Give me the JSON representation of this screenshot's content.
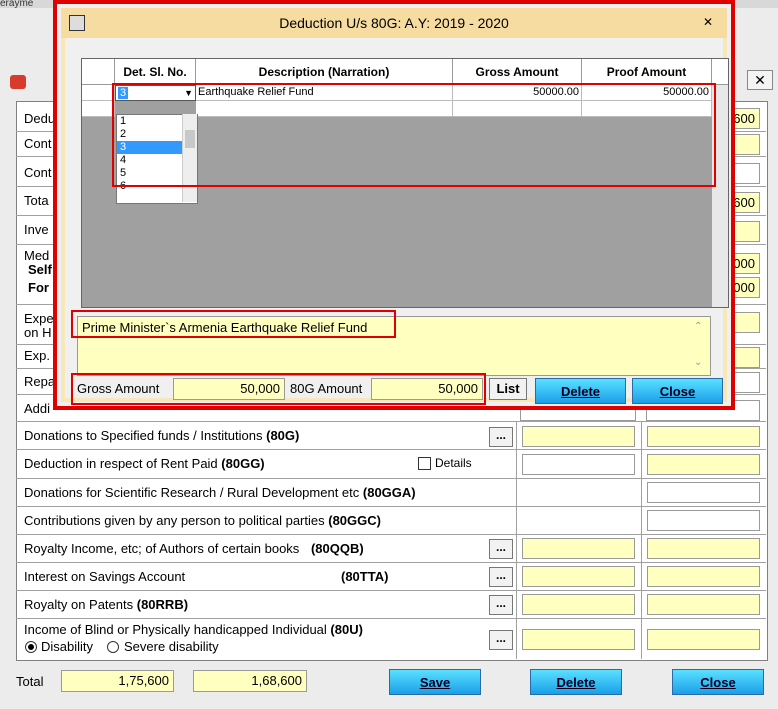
{
  "parent": {
    "top_fragment": "erayme",
    "rows": [
      {
        "label": "Dedu",
        "code": ""
      },
      {
        "label": "Cont",
        "code": ""
      },
      {
        "label": "Cont",
        "code": ""
      },
      {
        "label": "Tota",
        "code": ""
      },
      {
        "label": "Inve",
        "code": ""
      },
      {
        "label": "Med",
        "code": ""
      },
      {
        "label": "Self",
        "code": ""
      },
      {
        "label": "For",
        "code": ""
      },
      {
        "label": "Expe",
        "code": ""
      },
      {
        "label": "on H",
        "code": ""
      },
      {
        "label": "Exp.",
        "code": ""
      },
      {
        "label": "Repa",
        "code": ""
      },
      {
        "label": "Addi",
        "code": ""
      },
      {
        "label": "Donations to Specified funds / Institutions",
        "code": "(80G)"
      },
      {
        "label": "Deduction in respect of Rent Paid",
        "code": "(80GG)"
      },
      {
        "label": "Donations for Scientific Research / Rural Development etc",
        "code": "(80GGA)"
      },
      {
        "label": "Contributions given by any person to political parties",
        "code": "(80GGC)"
      },
      {
        "label": "Royalty Income, etc; of Authors of certain books",
        "code": "(80QQB)"
      },
      {
        "label": "Interest on Savings Account",
        "code": "(80TTA)"
      },
      {
        "label": "Royalty on Patents",
        "code": "(80RRB)"
      },
      {
        "label": "Income of Blind or Physically handicapped Individual",
        "code": "(80U)"
      }
    ],
    "right_values": [
      "600",
      "600",
      "000",
      "000"
    ],
    "details_label": "Details",
    "radio_disability": "Disability",
    "radio_severe": "Severe disability",
    "dots": "...",
    "total_label": "Total",
    "total_1": "1,75,600",
    "total_2": "1,68,600",
    "save_label": "Save",
    "delete_label": "Delete",
    "close_label": "Close"
  },
  "dialog": {
    "title": "Deduction U/s 80G: A.Y: 2019 - 2020",
    "close_x": "✕",
    "columns": [
      "Det. Sl. No.",
      "Description (Narration)",
      "Gross Amount",
      "Proof Amount"
    ],
    "row": {
      "sl": "3",
      "desc": "Earthquake Relief Fund",
      "gross": "50000.00",
      "proof": "50000.00"
    },
    "dropdown_options": [
      "1",
      "2",
      "3",
      "4",
      "5",
      "6"
    ],
    "dropdown_selected": "3",
    "narration": "Prime Minister`s Armenia Earthquake Relief Fund",
    "gross_label": "Gross Amount",
    "gross_value": "50,000",
    "amt80g_label": "80G Amount",
    "amt80g_value": "50,000",
    "list_label": "List",
    "delete_label": "Delete",
    "close_label": "Close"
  },
  "colors": {
    "accent": "#e00000",
    "field": "#ffffc0",
    "button": "#1a9fe8"
  }
}
